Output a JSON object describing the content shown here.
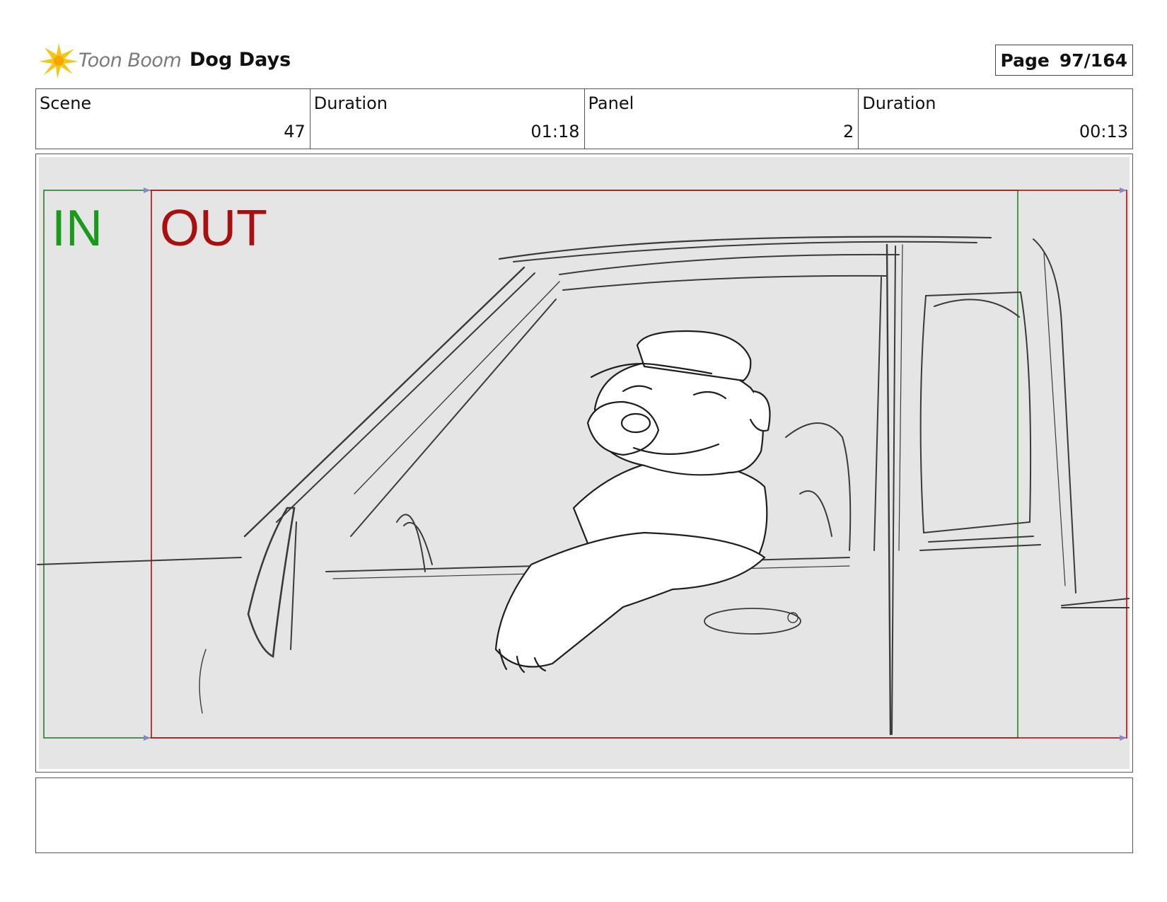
{
  "header": {
    "logo_text": "Toon Boom",
    "project_title": "Dog Days",
    "page_label": "Page",
    "page_number": "97/164"
  },
  "info": {
    "scene_label": "Scene",
    "scene_value": "47",
    "scene_duration_label": "Duration",
    "scene_duration_value": "01:18",
    "panel_label": "Panel",
    "panel_value": "2",
    "panel_duration_label": "Duration",
    "panel_duration_value": "00:13"
  },
  "panel": {
    "in_label": "IN",
    "out_label": "OUT",
    "in_color": "#1a9a1a",
    "out_color": "#a81010"
  },
  "notes": {
    "text": ""
  }
}
